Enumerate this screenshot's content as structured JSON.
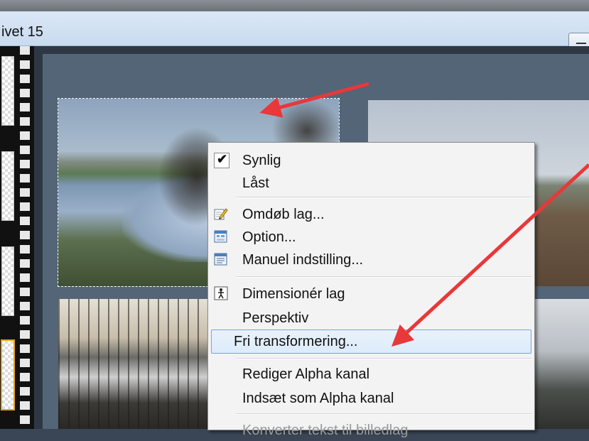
{
  "window": {
    "title": "ivet 15"
  },
  "context_menu": {
    "items": [
      {
        "label": "Synlig",
        "icon": "checkmark-icon",
        "checked": true
      },
      {
        "label": "Låst"
      },
      {
        "label": "Omdøb lag...",
        "icon": "rename-pencil-icon"
      },
      {
        "label": "Option...",
        "icon": "options-icon"
      },
      {
        "label": "Manuel indstilling...",
        "icon": "manual-settings-icon"
      },
      {
        "label": "Dimensionér lag",
        "icon": "resize-figure-icon"
      },
      {
        "label": "Perspektiv"
      },
      {
        "label": "Fri transformering...",
        "highlighted": true
      },
      {
        "label": "Rediger Alpha kanal"
      },
      {
        "label": "Indsæt som Alpha kanal"
      },
      {
        "label": "Konverter tekst til billedlag",
        "disabled": true
      }
    ]
  },
  "colors": {
    "annotation_arrow": "#e8383a",
    "menu_highlight_border": "#7da2ce",
    "selected_thumbnail_border": "#e8a21a"
  }
}
